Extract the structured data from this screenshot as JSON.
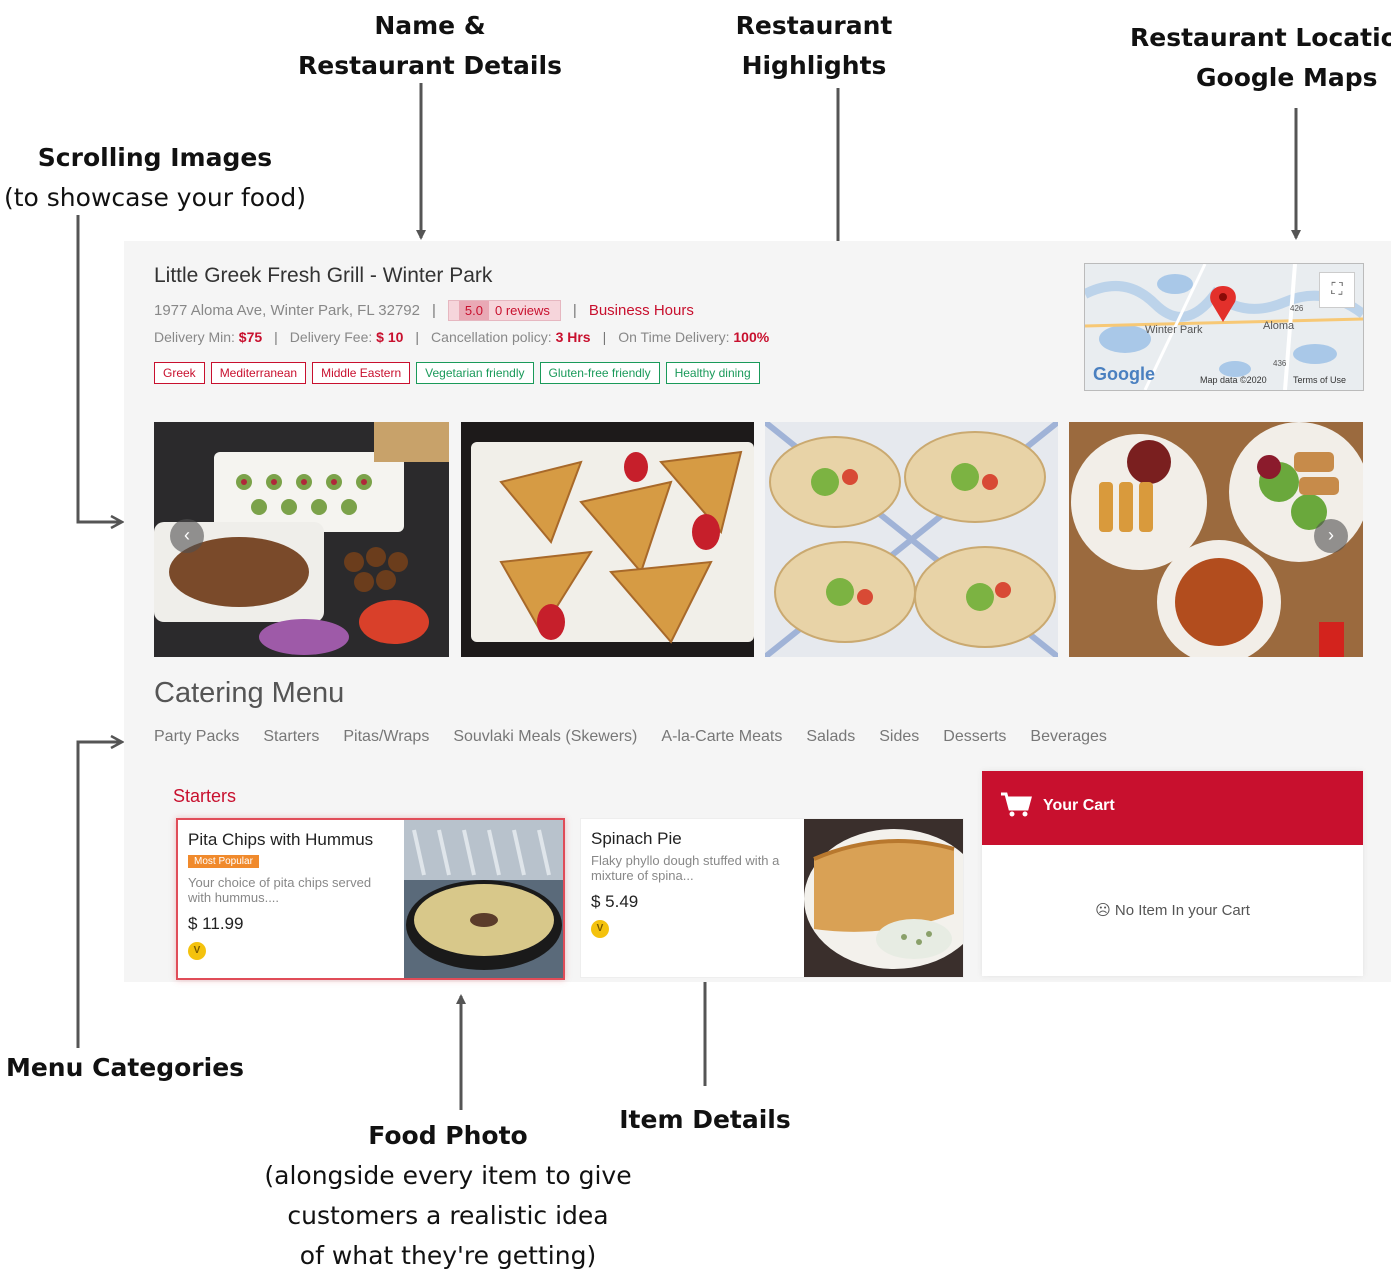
{
  "annotations": {
    "name_details": {
      "line1": "Name &",
      "line2": "Restaurant Details"
    },
    "highlights": {
      "line1": "Restaurant",
      "line2": "Highlights"
    },
    "location": {
      "line1": "Restaurant Location",
      "line2": "Google Maps"
    },
    "scrolling": {
      "title": "Scrolling Images",
      "sub": "(to showcase your food)"
    },
    "menu_categories": {
      "title": "Menu Categories"
    },
    "food_photo": {
      "title": "Food Photo",
      "sub1": "(alongside every item to give",
      "sub2": "customers a realistic idea",
      "sub3": "of what they're getting)"
    },
    "item_details": {
      "title": "Item Details"
    }
  },
  "restaurant": {
    "name": "Little Greek Fresh Grill - Winter Park",
    "address": "1977 Aloma Ave, Winter Park, FL 32792",
    "rating": "5.0",
    "reviews": "0 reviews",
    "business_hours": "Business Hours",
    "delivery_min_label": "Delivery Min:",
    "delivery_min": "$75",
    "delivery_fee_label": "Delivery Fee:",
    "delivery_fee": "$ 10",
    "cancellation_label": "Cancellation policy:",
    "cancellation": "3 Hrs",
    "ontime_label": "On Time Delivery:",
    "ontime": "100%"
  },
  "tags": [
    {
      "label": "Greek",
      "kind": "cuisine"
    },
    {
      "label": "Mediterranean",
      "kind": "cuisine"
    },
    {
      "label": "Middle Eastern",
      "kind": "cuisine"
    },
    {
      "label": "Vegetarian friendly",
      "kind": "highlight"
    },
    {
      "label": "Gluten-free friendly",
      "kind": "highlight"
    },
    {
      "label": "Healthy dining",
      "kind": "highlight"
    }
  ],
  "map": {
    "place1": "Winter Park",
    "place2": "Aloma",
    "road1": "426",
    "road2": "436",
    "logo": "Google",
    "data": "Map data ©2020",
    "terms": "Terms of Use",
    "fullscreen_icon": "fullscreen-icon"
  },
  "carousel": {
    "prev_icon": "chevron-left-icon",
    "next_icon": "chevron-right-icon",
    "photos": [
      "catering-platter",
      "baklava",
      "gyro-wraps",
      "meal-plate"
    ]
  },
  "menu": {
    "heading": "Catering Menu",
    "categories": [
      "Party Packs",
      "Starters",
      "Pitas/Wraps",
      "Souvlaki Meals (Skewers)",
      "A-la-Carte Meats",
      "Salads",
      "Sides",
      "Desserts",
      "Beverages"
    ],
    "section": "Starters",
    "items": [
      {
        "title": "Pita Chips with Hummus",
        "badge": "Most Popular",
        "desc": "Your choice of pita chips served with hummus....",
        "price": "$ 11.99",
        "veg": "V"
      },
      {
        "title": "Spinach Pie",
        "desc": "Flaky phyllo dough stuffed with a mixture of spina...",
        "price": "$ 5.49",
        "veg": "V"
      }
    ]
  },
  "cart": {
    "title": "Your Cart",
    "empty": "No Item In your Cart",
    "icon": "cart-icon"
  },
  "colors": {
    "brand_red": "#c8102e",
    "highlight_green": "#1a9a5a",
    "badge_orange": "#f08a2c"
  }
}
